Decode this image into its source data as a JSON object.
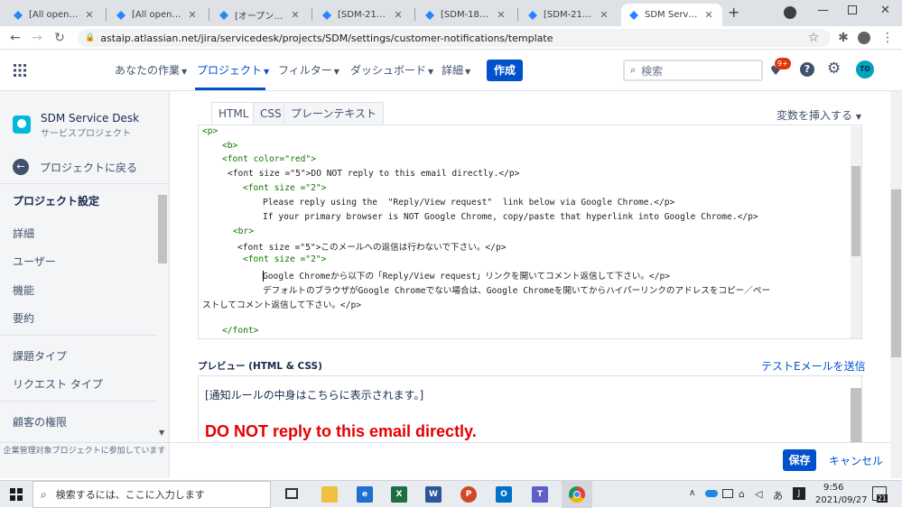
{
  "browser": {
    "tabs": [
      {
        "title": "[All open SDM",
        "active": false
      },
      {
        "title": "[All open SDM",
        "active": false
      },
      {
        "title": "[オープンな担当者",
        "active": false
      },
      {
        "title": "[SDM-21704] L",
        "active": false
      },
      {
        "title": "[SDM-18920] C",
        "active": false
      },
      {
        "title": "[SDM-21674] P",
        "active": false
      },
      {
        "title": "SDM Service D",
        "active": true
      }
    ],
    "new_tab": "+",
    "url": "astaip.atlassian.net/jira/servicedesk/projects/SDM/settings/customer-notifications/template"
  },
  "header": {
    "nav": [
      {
        "label": "あなたの作業"
      },
      {
        "label": "プロジェクト"
      },
      {
        "label": "フィルター"
      },
      {
        "label": "ダッシュボード"
      },
      {
        "label": "詳細"
      }
    ],
    "create_label": "作成",
    "search_placeholder": "検索",
    "notification_badge": "9+",
    "avatar_initials": "TO"
  },
  "sidebar": {
    "project_name": "SDM Service Desk",
    "project_type": "サービスプロジェクト",
    "back_label": "プロジェクトに戻る",
    "section_title": "プロジェクト設定",
    "items": [
      "詳細",
      "ユーザー",
      "機能",
      "要約",
      "課題タイプ",
      "リクエスト タイプ",
      "顧客の権限"
    ],
    "footer": "企業管理対象プロジェクトに参加しています"
  },
  "editor": {
    "tabs": [
      "HTML",
      "CSS",
      "プレーンテキスト"
    ],
    "insert_variable": "変数を挿入する",
    "lines": [
      "<p>",
      "<b>",
      "<font color=\"red\">",
      "<font size =\"5\">DO NOT reply to this email directly.</p>",
      "<font size =\"2\">",
      "Please reply using the  \"Reply/View request\"  link below via Google Chrome.</p>",
      "If your primary browser is NOT Google Chrome, copy/paste that hyperlink into Google Chrome.</p>",
      "<br>",
      "<font size =\"5\">このメールへの返信は行わないで下さい。</p>",
      "<font size =\"2\">",
      "Google Chromeから以下の「Reply/View request」リンクを開いてコメント返信して下さい。</p>",
      "デフォルトのブラウザがGoogle Chromeでない場合は、Google Chromeを開いてからハイパーリンクのアドレスをコピー／ペー",
      "ストしてコメント返信して下さい。</p>",
      "",
      "</font>"
    ]
  },
  "preview": {
    "title": "プレビュー (HTML & CSS)",
    "test_email": "テストEメールを送信",
    "placeholder_text": "[通知ルールの中身はこちらに表示されます。]",
    "red_heading": "DO NOT reply to this email directly."
  },
  "actions": {
    "save": "保存",
    "cancel": "キャンセル"
  },
  "taskbar": {
    "search_placeholder": "検索するには、ここに入力します",
    "time": "9:56",
    "date": "2021/09/27",
    "notification_count": "21"
  },
  "colors": {
    "accent": "#0052cc",
    "badge": "#de350b",
    "preview_red": "#e60000"
  }
}
